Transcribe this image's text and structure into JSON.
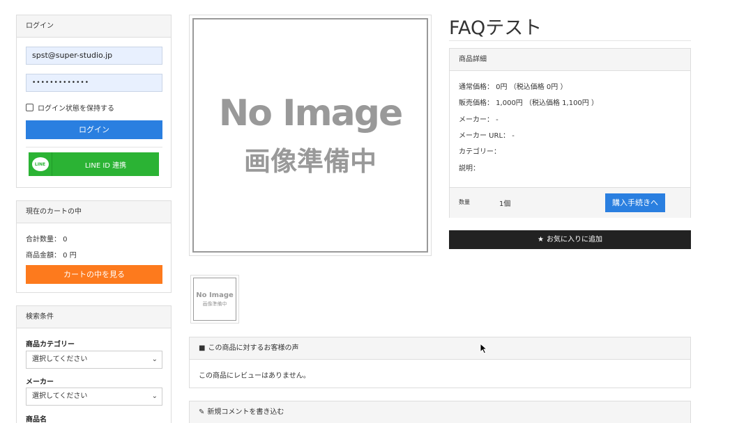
{
  "login": {
    "header": "ログイン",
    "email_value": "spst@super-studio.jp",
    "password_value": "•••••••••••••",
    "remember_label": "ログイン状態を保持する",
    "login_button": "ログイン",
    "line_logo": "LINE",
    "line_button": "LINE ID 連携"
  },
  "cart": {
    "header": "現在のカートの中",
    "total_qty": "合計数量： 0",
    "total_price": "商品金額： 0 円",
    "view_button": "カートの中を見る"
  },
  "search": {
    "header": "検索条件",
    "category_label": "商品カテゴリー",
    "category_value": "選択してください",
    "maker_label": "メーカー",
    "maker_value": "選択してください",
    "name_label": "商品名"
  },
  "product": {
    "image_line1": "No Image",
    "image_line2": "画像準備中",
    "title": "FAQテスト",
    "detail_header": "商品詳細",
    "list_price": "通常価格： 0円 （税込価格 0円 ）",
    "sale_price": "販売価格： 1,000円 （税込価格 1,100円 ）",
    "maker": "メーカー： -",
    "maker_url": "メーカー URL： -",
    "category": "カテゴリー：",
    "description": "説明：",
    "qty_label": "数量",
    "qty_value": "1個",
    "buy_button": "購入手続きへ",
    "fav_button": "お気に入りに追加"
  },
  "review": {
    "header": "この商品に対するお客様の声",
    "empty_text": "この商品にレビューはありません。"
  },
  "comment": {
    "header": "新規コメントを書き込む"
  },
  "icons": {
    "star": "star-icon",
    "comment": "comment-icon",
    "pencil": "pencil-icon",
    "chevron": "chevron-down-icon",
    "cursor": "mouse-cursor"
  },
  "colors": {
    "primary_blue": "#2a7fe0",
    "orange": "#fd7a1d",
    "line_green": "#2bb334",
    "dark": "#222222"
  }
}
